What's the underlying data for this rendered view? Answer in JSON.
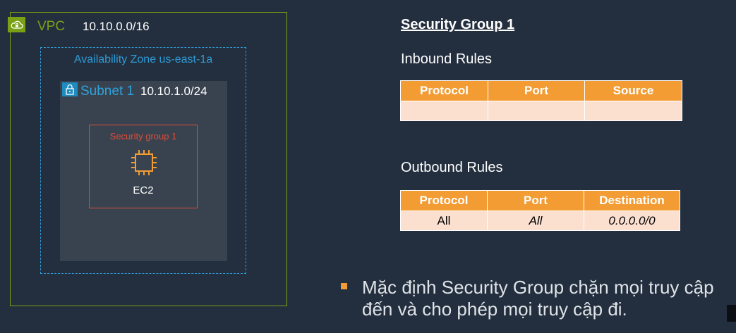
{
  "diagram": {
    "vpc": {
      "label": "VPC",
      "cidr": "10.10.0.0/16",
      "icon": "cloud-lock-icon"
    },
    "availability_zone": {
      "label": "Availability Zone us-east-1a"
    },
    "subnet": {
      "label": "Subnet 1",
      "cidr": "10.10.1.0/24",
      "icon": "padlock-icon"
    },
    "security_group": {
      "label": "Security group 1"
    },
    "instance": {
      "label": "EC2",
      "icon": "ec2-chip-icon"
    }
  },
  "colors": {
    "vpc": "#7aa116",
    "availability_zone": "#2e9bd6",
    "subnet": "#2ea3dc",
    "security_group": "#dd4b39",
    "table_header": "#f39c34",
    "table_row": "#fbe0d0",
    "background": "#232f3e"
  },
  "rules_panel": {
    "title": "Security Group 1",
    "inbound": {
      "title": "Inbound Rules",
      "headers": [
        "Protocol",
        "Port",
        "Source"
      ],
      "rows": [
        [
          "",
          "",
          ""
        ]
      ]
    },
    "outbound": {
      "title": "Outbound Rules",
      "headers": [
        "Protocol",
        "Port",
        "Destination"
      ],
      "rows": [
        [
          "All",
          "All",
          "0.0.0.0/0"
        ]
      ]
    }
  },
  "note": {
    "text": "Mặc định Security Group chặn mọi truy cập đến và cho phép mọi truy cập đi."
  }
}
